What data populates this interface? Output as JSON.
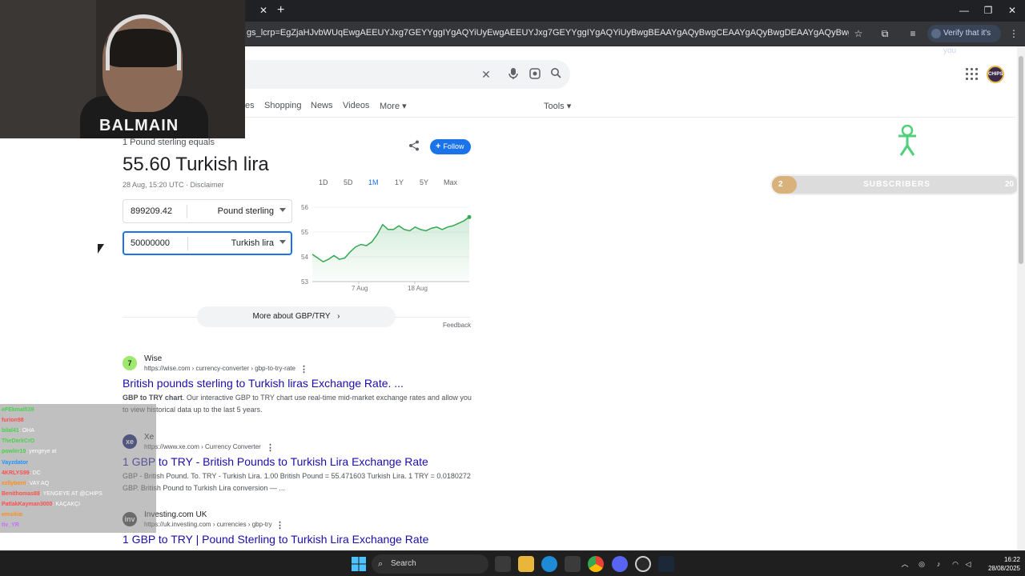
{
  "browser": {
    "url": "gs_lcrp=EgZjaHJvbWUqEwgAEEUYJxg7GEYYggIYgAQYiUyEwgAEEUYJxg7GEYYggIYgAQYiUyBwgBEAAYgAQyBwgCEAAYgAQyBwgDEAAYgAQyBwgEEAAYgAQyBwgFEAAYgAQyCAgGE...",
    "verify_label": "Verify that it's you",
    "tab_close": "✕",
    "new_tab": "+"
  },
  "google": {
    "nav_tabs": [
      {
        "label": "es"
      },
      {
        "label": "Shopping"
      },
      {
        "label": "News"
      },
      {
        "label": "Videos"
      },
      {
        "label": "More"
      },
      {
        "label": "Tools"
      }
    ],
    "avatar_text": "CHIPS"
  },
  "converter": {
    "subtitle": "1 Pound sterling equals",
    "headline": "55.60 Turkish lira",
    "date": "28 Aug, 15:20 UTC · Disclaimer",
    "follow_label": "Follow",
    "from_value": "899209.42",
    "from_currency": "Pound sterling",
    "to_value": "50000000",
    "to_currency": "Turkish lira",
    "ranges": [
      "1D",
      "5D",
      "1M",
      "1Y",
      "5Y",
      "Max"
    ],
    "selected_range": "1M",
    "more_label": "More about GBP/TRY",
    "feedback": "Feedback"
  },
  "chart_data": {
    "type": "area",
    "title": "",
    "xlabel": "",
    "ylabel": "",
    "ylim": [
      53,
      56
    ],
    "y_ticks": [
      "56",
      "55",
      "54",
      "53"
    ],
    "x_ticks": [
      "7 Aug",
      "18 Aug"
    ],
    "color": "#34a853",
    "series": [
      {
        "x": [
          0,
          1,
          2,
          3,
          4,
          5,
          6,
          7,
          8,
          9,
          10,
          11,
          12,
          13,
          14,
          15,
          16,
          17,
          18,
          19,
          20,
          21,
          22,
          23,
          24,
          25,
          26,
          27,
          28,
          29
        ],
        "values": [
          54.1,
          53.95,
          53.8,
          53.9,
          54.05,
          53.9,
          53.95,
          54.2,
          54.4,
          54.5,
          54.45,
          54.6,
          54.9,
          55.3,
          55.1,
          55.1,
          55.25,
          55.1,
          55.05,
          55.2,
          55.1,
          55.05,
          55.15,
          55.2,
          55.1,
          55.2,
          55.25,
          55.35,
          55.45,
          55.6
        ]
      }
    ]
  },
  "results": [
    {
      "site": "Wise",
      "url": "https://wise.com › currency-converter › gbp-to-try-rate",
      "title": "British pounds sterling to Turkish liras Exchange Rate. ...",
      "snippet_bold": "GBP to TRY chart",
      "snippet": ". Our interactive GBP to TRY chart use real-time mid-market exchange rates and allow you to view historical data up to the last 5 years.",
      "fav_text": "7",
      "fav_bg": "#9fe870",
      "fav_color": "#163300"
    },
    {
      "site": "Xe",
      "url": "https://www.xe.com › Currency Converter",
      "title": "1 GBP to TRY - British Pounds to Turkish Lira Exchange Rate",
      "snippet_bold": "",
      "snippet": "GBP - British Pound. To. TRY - Turkish Lira. 1.00 British Pound = 55.471603 Turkish Lira. 1 TRY = 0.0180272 GBP. British Pound to Turkish Lira conversion — ...",
      "fav_text": "xe",
      "fav_bg": "#0a146e",
      "fav_color": "#ffffff"
    },
    {
      "site": "Investing.com UK",
      "url": "https://uk.investing.com › currencies › gbp-try",
      "title": "1 GBP to TRY | Pound Sterling to Turkish Lira Exchange Rate",
      "snippet_bold": "",
      "snippet": "",
      "fav_text": "inv",
      "fav_bg": "#444444",
      "fav_color": "#ffffff"
    }
  ],
  "webcam": {
    "shirt_text": "BALMAIN"
  },
  "chat": [
    {
      "user": "eFEkmal539",
      "msg": "",
      "color": "#4ad14a"
    },
    {
      "user": "furion98",
      "msg": "",
      "color": "#ff4d4d"
    },
    {
      "user": "bilal41",
      "msg": "OHA",
      "color": "#4ad14a"
    },
    {
      "user": "TheDarkCrO",
      "msg": "",
      "color": "#4ad14a"
    },
    {
      "user": "powler10",
      "msg": "yengeye at",
      "color": "#4ad14a"
    },
    {
      "user": "Vayzdator",
      "msg": "",
      "color": "#1e90ff"
    },
    {
      "user": "4KRLYS99",
      "msg": "DC",
      "color": "#ff4d4d"
    },
    {
      "user": "ezllyberri",
      "msg": "VAY AQ",
      "color": "#ff8c1a"
    },
    {
      "user": "Benithomas88",
      "msg": "YENGEYE AT @CHIPS",
      "color": "#ff4d4d"
    },
    {
      "user": "PatlakKayman3000",
      "msg": "KAÇAKÇI",
      "color": "#ff4d4d"
    },
    {
      "user": "emsikio",
      "msg": "",
      "color": "#ff8c1a"
    },
    {
      "user": "tiv_YR",
      "msg": "",
      "color": "#c86bff"
    }
  ],
  "subscribers": {
    "start": "2",
    "label": "SUBSCRIBERS",
    "goal": "20",
    "progress": 0.1
  },
  "taskbar": {
    "search_label": "Search",
    "time": "16:22",
    "date": "28/08/2025"
  }
}
